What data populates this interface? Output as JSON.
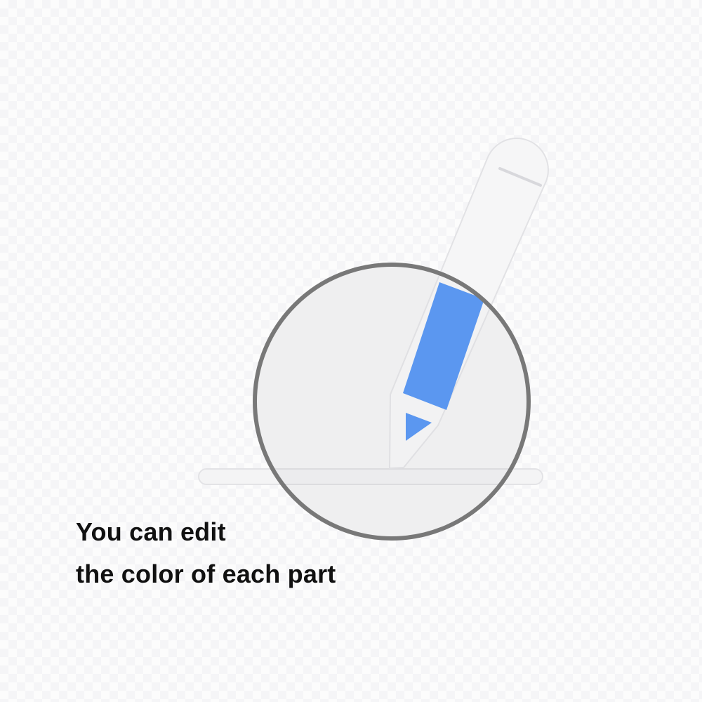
{
  "caption": {
    "line1": "You can edit",
    "line2": "the color of each part"
  },
  "colors": {
    "pencil_accent": "#5b97f0",
    "pencil_outline": "#ececee",
    "magnifier_ring": "#787878",
    "magnifier_lens": "#efeff0",
    "text": "#111111"
  },
  "icons": {
    "main": "pencil-icon",
    "overlay": "magnifier-lens"
  }
}
